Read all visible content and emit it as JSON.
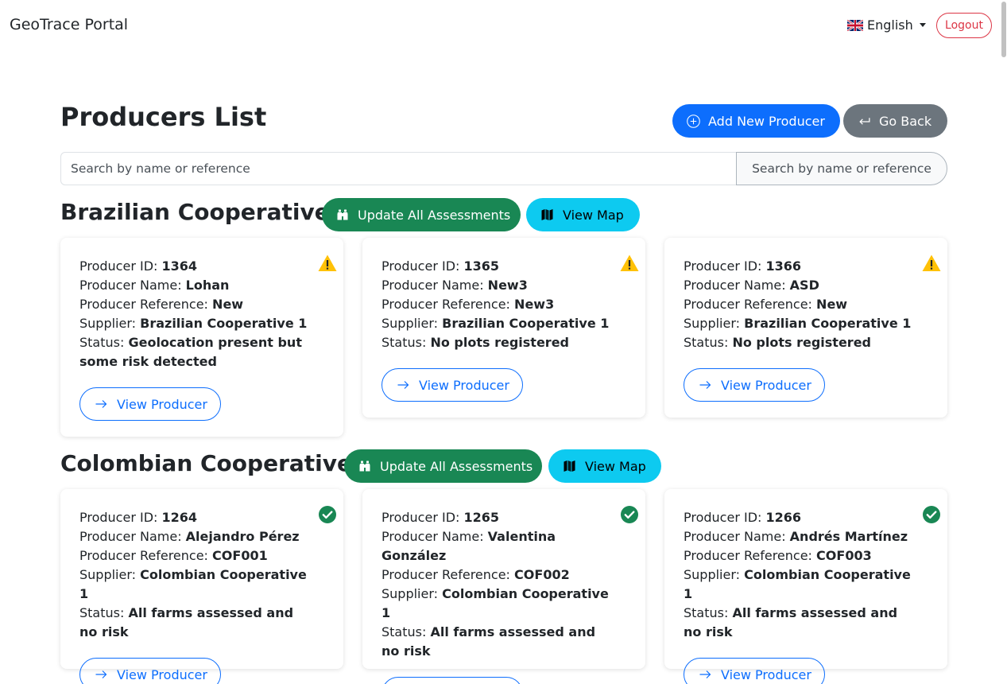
{
  "header": {
    "brand": "GeoTrace Portal",
    "language": "English",
    "logout_label": "Logout"
  },
  "page": {
    "title": "Producers List",
    "add_button": "Add New Producer",
    "back_button": "Go Back",
    "search_placeholder": "Search by name or reference",
    "search_addon": "Search by name or reference"
  },
  "labels": {
    "producer_id": "Producer ID:",
    "producer_name": "Producer Name:",
    "producer_reference": "Producer Reference:",
    "supplier": "Supplier:",
    "status": "Status:",
    "view_producer": "View Producer",
    "update_all": "Update All Assessments",
    "view_map": "View Map"
  },
  "groups": [
    {
      "name": "Brazilian Cooperative 1",
      "producers": [
        {
          "id": "1364",
          "name": "Lohan",
          "reference": "New",
          "supplier": "Brazilian Cooperative 1",
          "status": "Geolocation present but some risk detected",
          "icon": "warning-icon"
        },
        {
          "id": "1365",
          "name": "New3",
          "reference": "New3",
          "supplier": "Brazilian Cooperative 1",
          "status": "No plots registered",
          "icon": "warning-icon"
        },
        {
          "id": "1366",
          "name": "ASD",
          "reference": "New",
          "supplier": "Brazilian Cooperative 1",
          "status": "No plots registered",
          "icon": "warning-icon"
        }
      ]
    },
    {
      "name": "Colombian Cooperative 1",
      "producers": [
        {
          "id": "1264",
          "name": "Alejandro Pérez",
          "reference": "COF001",
          "supplier": "Colombian Cooperative 1",
          "status": "All farms assessed and no risk",
          "icon": "check-circle-icon"
        },
        {
          "id": "1265",
          "name": "Valentina González",
          "reference": "COF002",
          "supplier": "Colombian Cooperative 1",
          "status": "All farms assessed and no risk",
          "icon": "check-circle-icon"
        },
        {
          "id": "1266",
          "name": "Andrés Martínez",
          "reference": "COF003",
          "supplier": "Colombian Cooperative 1",
          "status": "All farms assessed and no risk",
          "icon": "check-circle-icon"
        }
      ]
    }
  ],
  "colors": {
    "primary": "#0d6efd",
    "secondary": "#6c757d",
    "success": "#198754",
    "info": "#0dcaf0",
    "danger": "#dc3545",
    "warning": "#ffc107"
  }
}
